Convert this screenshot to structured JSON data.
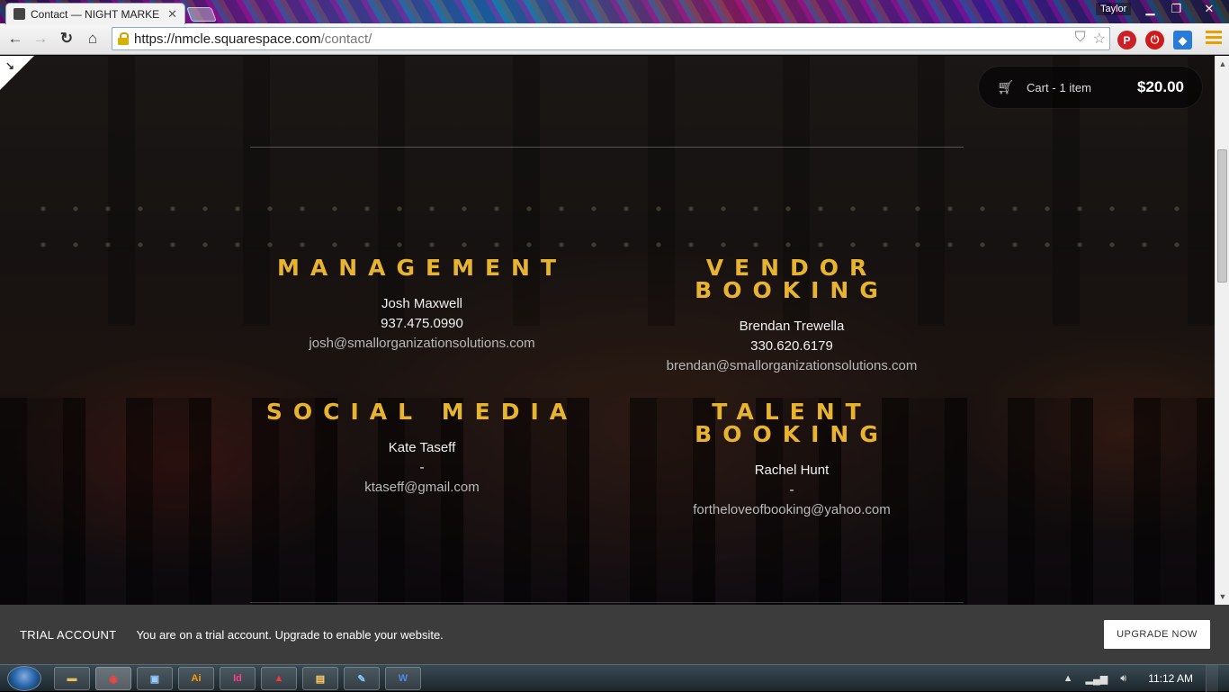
{
  "browser": {
    "tab_title": "Contact — NIGHT MARKE",
    "user_name": "Taylor",
    "url_host": "https://nmcle.squarespace.com",
    "url_path": "/contact/"
  },
  "cart": {
    "label": "Cart -",
    "count": "1 item",
    "total": "$20.00"
  },
  "contacts": [
    {
      "heading": "Management",
      "name": "Josh Maxwell",
      "phone": "937.475.0990",
      "email": "josh@smallorganizationsolutions.com"
    },
    {
      "heading": "Vendor Booking",
      "name": "Brendan Trewella",
      "phone": "330.620.6179",
      "email": "brendan@smallorganizationsolutions.com"
    },
    {
      "heading": "Social Media",
      "name": "Kate Taseff",
      "phone": "-",
      "email": "ktaseff@gmail.com"
    },
    {
      "heading": "Talent Booking",
      "name": "Rachel Hunt",
      "phone": "-",
      "email": "fortheloveofbooking@yahoo.com"
    }
  ],
  "trial": {
    "label": "TRIAL ACCOUNT",
    "message": "You are on a trial account. Upgrade to enable your website.",
    "button": "UPGRADE NOW"
  },
  "taskbar": {
    "apps": [
      "explorer",
      "chrome",
      "remote-desktop",
      "illustrator",
      "indesign",
      "acrobat",
      "file-manager",
      "paint",
      "word"
    ],
    "app_labels": [
      "Ai",
      "Id",
      "W"
    ],
    "clock": "11:12 AM"
  },
  "colors": {
    "heading_gold": "#e8b430",
    "trial_bar": "#3c3c3c"
  }
}
